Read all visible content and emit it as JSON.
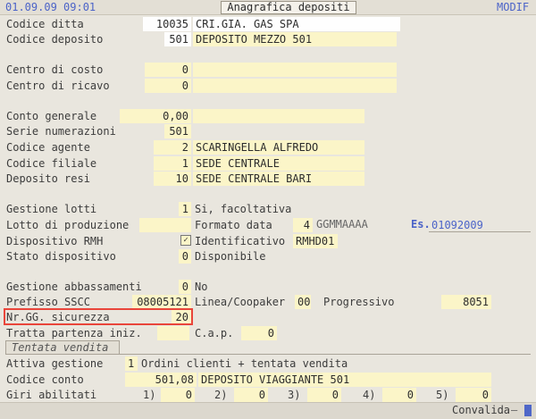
{
  "header": {
    "date_time": "01.09.09 09:01",
    "title": "Anagrafica depositi",
    "mode": "MODIF"
  },
  "fields": {
    "codice_ditta": {
      "label": "Codice ditta",
      "code": "10035",
      "desc": "CRI.GIA. GAS SPA"
    },
    "codice_deposito": {
      "label": "Codice deposito",
      "code": "501",
      "desc": "DEPOSITO MEZZO 501"
    },
    "centro_costo": {
      "label": "Centro di costo",
      "code": "0",
      "desc": ""
    },
    "centro_ricavo": {
      "label": "Centro di ricavo",
      "code": "0",
      "desc": ""
    },
    "conto_generale": {
      "label": "Conto  generale",
      "code": "0,00",
      "desc": ""
    },
    "serie_numerazioni": {
      "label": "Serie  numerazioni",
      "code": "501"
    },
    "codice_agente": {
      "label": "Codice agente",
      "code": "2",
      "desc": "SCARINGELLA ALFREDO"
    },
    "codice_filiale": {
      "label": "Codice filiale",
      "code": "1",
      "desc": "SEDE CENTRALE"
    },
    "deposito_resi": {
      "label": "Deposito resi",
      "code": "10",
      "desc": "SEDE CENTRALE BARI"
    },
    "gestione_lotti": {
      "label": "Gestione lotti",
      "code": "1",
      "desc": "Si, facoltativa"
    },
    "lotto_produzione": {
      "label": "Lotto di produzione",
      "value": ""
    },
    "formato_data": {
      "label": "Formato data",
      "code": "4",
      "desc": "GGMMAAAA",
      "es_label": "Es.",
      "es_value": "01092009"
    },
    "dispositivo_rmh": {
      "label": "Dispositivo RMH",
      "checked_glyph": "✓"
    },
    "identificativo": {
      "label": "Identificativo",
      "value": "RMHD01"
    },
    "stato_dispositivo": {
      "label": "Stato dispositivo",
      "code": "0",
      "desc": "Disponibile"
    },
    "gestione_abbassamenti": {
      "label": "Gestione abbassamenti",
      "code": "0",
      "desc": "No"
    },
    "prefisso_sscc": {
      "label": "Prefisso SSCC",
      "value": "08005121"
    },
    "linea_coopaker": {
      "label": "Linea/Coopaker",
      "value": "00"
    },
    "progressivo": {
      "label": "Progressivo",
      "value": "8051"
    },
    "nr_gg_sicurezza": {
      "label": "Nr.GG. sicurezza",
      "value": "20"
    },
    "tratta_partenza": {
      "label": "Tratta partenza iniz.",
      "value": ""
    },
    "cap": {
      "label": "C.a.p.",
      "value": "0"
    }
  },
  "section": {
    "title": "Tentata vendita"
  },
  "tentata": {
    "attiva_gestione": {
      "label": "Attiva gestione",
      "code": "1",
      "desc": "Ordini clienti + tentata vendita"
    },
    "codice_conto": {
      "label": "Codice conto",
      "code": "501,08",
      "desc": "DEPOSITO VIAGGIANTE 501"
    },
    "giri": {
      "label": "Giri   abilitati",
      "items": [
        {
          "n": "1)",
          "v": "0"
        },
        {
          "n": "2)",
          "v": "0"
        },
        {
          "n": "3)",
          "v": "0"
        },
        {
          "n": "4)",
          "v": "0"
        },
        {
          "n": "5)",
          "v": "0"
        }
      ]
    }
  },
  "status": {
    "text": "Convalida"
  }
}
